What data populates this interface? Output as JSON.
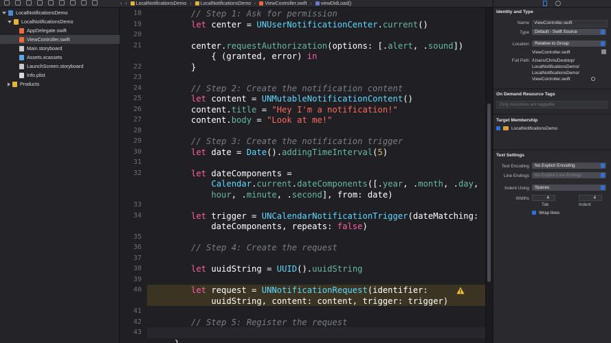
{
  "jumpbar": {
    "crumbs": [
      "LocalNotificationsDemo",
      "LocalNotificationsDemo",
      "ViewController.swift",
      "viewDidLoad()"
    ]
  },
  "navigator": {
    "items": [
      {
        "label": "LocalNotificationsDemo",
        "icon": "project-icon"
      },
      {
        "label": "LocalNotificationsDemo",
        "icon": "folder-icon"
      },
      {
        "label": "AppDelegate.swift",
        "icon": "swift-file-icon"
      },
      {
        "label": "ViewController.swift",
        "icon": "swift-file-icon",
        "selected": true
      },
      {
        "label": "Main.storyboard",
        "icon": "storyboard-icon"
      },
      {
        "label": "Assets.xcassets",
        "icon": "assets-icon"
      },
      {
        "label": "LaunchScreen.storyboard",
        "icon": "storyboard-icon"
      },
      {
        "label": "Info.plist",
        "icon": "plist-icon"
      },
      {
        "label": "Products",
        "icon": "folder-icon"
      }
    ]
  },
  "editor": {
    "lines": [
      {
        "n": "18",
        "tokens": [
          [
            "cm",
            "// Step 1: Ask for permission"
          ]
        ]
      },
      {
        "n": "19",
        "tokens": [
          [
            "kw",
            "let"
          ],
          [
            "pl",
            " center = "
          ],
          [
            "ty",
            "UNUserNotificationCenter"
          ],
          [
            "pl",
            "."
          ],
          [
            "fn",
            "current"
          ],
          [
            "pl",
            "()"
          ]
        ]
      },
      {
        "n": "20",
        "tokens": []
      },
      {
        "n": "21",
        "tokens": [
          [
            "pl",
            "center."
          ],
          [
            "fn",
            "requestAuthorization"
          ],
          [
            "pl",
            "(options: [."
          ],
          [
            "fn",
            "alert"
          ],
          [
            "pl",
            ", ."
          ],
          [
            "fn",
            "sound"
          ],
          [
            "pl",
            "])"
          ]
        ]
      },
      {
        "n": "",
        "tokens": [
          [
            "pl",
            "    { (granted, error) "
          ],
          [
            "kw",
            "in"
          ]
        ]
      },
      {
        "n": "22",
        "tokens": [
          [
            "pl",
            "}"
          ]
        ]
      },
      {
        "n": "23",
        "tokens": []
      },
      {
        "n": "24",
        "tokens": [
          [
            "cm",
            "// Step 2: Create the notification content"
          ]
        ]
      },
      {
        "n": "25",
        "tokens": [
          [
            "kw",
            "let"
          ],
          [
            "pl",
            " content = "
          ],
          [
            "ty",
            "UNMutableNotificationContent"
          ],
          [
            "pl",
            "()"
          ]
        ]
      },
      {
        "n": "26",
        "tokens": [
          [
            "pl",
            "content."
          ],
          [
            "fn",
            "title"
          ],
          [
            "pl",
            " = "
          ],
          [
            "str",
            "\"Hey I'm a notification!\""
          ]
        ]
      },
      {
        "n": "27",
        "tokens": [
          [
            "pl",
            "content."
          ],
          [
            "fn",
            "body"
          ],
          [
            "pl",
            " = "
          ],
          [
            "str",
            "\"Look at me!\""
          ]
        ]
      },
      {
        "n": "28",
        "tokens": []
      },
      {
        "n": "29",
        "tokens": [
          [
            "cm",
            "// Step 3: Create the notification trigger"
          ]
        ]
      },
      {
        "n": "30",
        "tokens": [
          [
            "kw",
            "let"
          ],
          [
            "pl",
            " date = "
          ],
          [
            "ty",
            "Date"
          ],
          [
            "pl",
            "()."
          ],
          [
            "fn",
            "addingTimeInterval"
          ],
          [
            "pl",
            "("
          ],
          [
            "num",
            "5"
          ],
          [
            "pl",
            ")"
          ]
        ]
      },
      {
        "n": "31",
        "tokens": []
      },
      {
        "n": "32",
        "tokens": [
          [
            "kw",
            "let"
          ],
          [
            "pl",
            " dateComponents ="
          ]
        ]
      },
      {
        "n": "",
        "tokens": [
          [
            "pl",
            "    "
          ],
          [
            "ty",
            "Calendar"
          ],
          [
            "pl",
            "."
          ],
          [
            "fn",
            "current"
          ],
          [
            "pl",
            "."
          ],
          [
            "fn",
            "dateComponents"
          ],
          [
            "pl",
            "([."
          ],
          [
            "fn",
            "year"
          ],
          [
            "pl",
            ", ."
          ],
          [
            "fn",
            "month"
          ],
          [
            "pl",
            ", ."
          ],
          [
            "fn",
            "day"
          ],
          [
            "pl",
            ", ."
          ]
        ]
      },
      {
        "n": "",
        "tokens": [
          [
            "pl",
            "    "
          ],
          [
            "fn",
            "hour"
          ],
          [
            "pl",
            ", ."
          ],
          [
            "fn",
            "minute"
          ],
          [
            "pl",
            ", ."
          ],
          [
            "fn",
            "second"
          ],
          [
            "pl",
            "], from: date)"
          ]
        ]
      },
      {
        "n": "33",
        "tokens": []
      },
      {
        "n": "34",
        "tokens": [
          [
            "kw",
            "let"
          ],
          [
            "pl",
            " trigger = "
          ],
          [
            "ty",
            "UNCalendarNotificationTrigger"
          ],
          [
            "pl",
            "(dateMatching:"
          ]
        ]
      },
      {
        "n": "",
        "tokens": [
          [
            "pl",
            "    dateComponents, repeats: "
          ],
          [
            "kw",
            "false"
          ],
          [
            "pl",
            ")"
          ]
        ]
      },
      {
        "n": "35",
        "tokens": []
      },
      {
        "n": "36",
        "tokens": [
          [
            "cm",
            "// Step 4: Create the request"
          ]
        ]
      },
      {
        "n": "37",
        "tokens": []
      },
      {
        "n": "38",
        "tokens": [
          [
            "kw",
            "let"
          ],
          [
            "pl",
            " uuidString = "
          ],
          [
            "ty",
            "UUID"
          ],
          [
            "pl",
            "()."
          ],
          [
            "fn",
            "uuidString"
          ]
        ]
      },
      {
        "n": "39",
        "tokens": []
      },
      {
        "n": "40",
        "tokens": [
          [
            "kw",
            "let"
          ],
          [
            "pl",
            " request = "
          ],
          [
            "ty",
            "UNNotificationRequest"
          ],
          [
            "pl",
            "(identifier:"
          ]
        ],
        "warning": true
      },
      {
        "n": "",
        "tokens": [
          [
            "pl",
            "    uuidString, content: content, trigger: trigger)"
          ]
        ],
        "warning": true
      },
      {
        "n": "41",
        "tokens": []
      },
      {
        "n": "42",
        "tokens": [
          [
            "cm",
            "// Step 5: Register the request"
          ]
        ]
      },
      {
        "n": "43",
        "tokens": [],
        "current": true
      },
      {
        "n": "",
        "tokens": [
          [
            "pl",
            "}"
          ]
        ]
      }
    ]
  },
  "inspector": {
    "identity": {
      "title": "Identity and Type",
      "name_label": "Name",
      "name_value": "ViewController.swift",
      "type_label": "Type",
      "type_value": "Default - Swift Source",
      "location_label": "Location",
      "location_value": "Relative to Group",
      "location_file": "ViewController.swift",
      "fullpath_label": "Full Path",
      "fullpath_lines": [
        "/Users/Chris/Desktop/",
        "LocalNotificationsDemo/",
        "LocalNotificationsDemo/",
        "ViewController.swift"
      ]
    },
    "odr": {
      "title": "On Demand Resource Tags",
      "placeholder": "Only resources are taggable"
    },
    "target": {
      "title": "Target Membership",
      "item": "LocalNotificationsDemo",
      "checked": true
    },
    "text_settings": {
      "title": "Text Settings",
      "encoding_label": "Text Encoding",
      "encoding_value": "No Explicit Encoding",
      "endings_label": "Line Endings",
      "endings_value": "No Explicit Line Endings",
      "indent_label": "Indent Using",
      "indent_value": "Spaces",
      "widths_label": "Widths",
      "tab_value": "4",
      "indent_width_value": "4",
      "tab_caption": "Tab",
      "indent_caption": "Indent",
      "wrap_label": "Wrap lines",
      "wrap_checked": true
    }
  },
  "colors": {
    "keyword": "#fc5fa3",
    "type": "#5dd8ff",
    "function": "#67b7a4",
    "comment": "#7a7e87",
    "string": "#fc6a5d",
    "number": "#d0bf69",
    "warning_band": "#3b3423",
    "accent": "#2f6fd6"
  }
}
